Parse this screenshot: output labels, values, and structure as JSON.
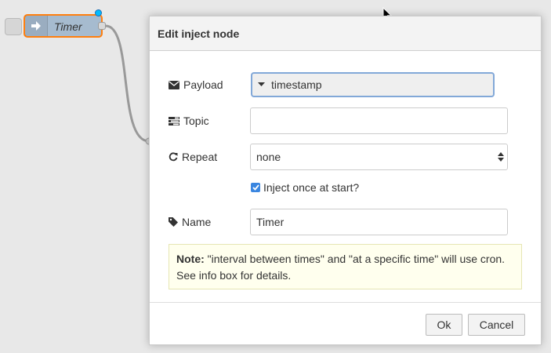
{
  "flow": {
    "node": {
      "label": "Timer",
      "color": "#a6bbcf",
      "selected_border": "#ff7f0e"
    }
  },
  "dialog": {
    "title": "Edit inject node",
    "fields": {
      "payload": {
        "label": "Payload",
        "icon": "envelope-icon",
        "value": "timestamp"
      },
      "topic": {
        "label": "Topic",
        "icon": "tasks-icon",
        "value": ""
      },
      "repeat": {
        "label": "Repeat",
        "icon": "repeat-icon",
        "value": "none"
      },
      "once": {
        "label": "Inject once at start?",
        "checked": true
      },
      "name": {
        "label": "Name",
        "icon": "tag-icon",
        "value": "Timer"
      }
    },
    "note": {
      "prefix": "Note:",
      "text": " \"interval between times\" and \"at a specific time\" will use cron. See info box for details."
    },
    "buttons": {
      "ok": "Ok",
      "cancel": "Cancel"
    }
  }
}
